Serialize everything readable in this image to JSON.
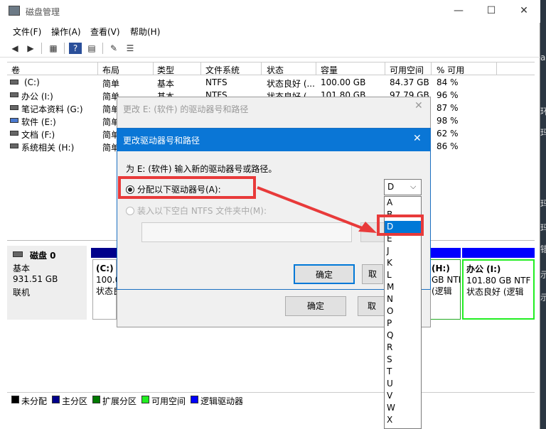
{
  "window": {
    "title": "磁盘管理",
    "minimize": "—",
    "maximize": "☐",
    "close": "✕"
  },
  "menu": [
    "文件(F)",
    "操作(A)",
    "查看(V)",
    "帮助(H)"
  ],
  "toolbar": [
    "◀",
    "▶",
    "▦",
    "?",
    "▤",
    "✎",
    "☰"
  ],
  "volume_table": {
    "columns": [
      "卷",
      "布局",
      "类型",
      "文件系统",
      "状态",
      "容量",
      "可用空间",
      "% 可用"
    ],
    "rows": [
      [
        "(C:)",
        "简单",
        "基本",
        "NTFS",
        "状态良好 (...",
        "100.00 GB",
        "84.37 GB",
        "84 %"
      ],
      [
        "办公 (I:)",
        "简单",
        "基本",
        "NTFS",
        "状态良好 (...",
        "101.80 GB",
        "97.79 GB",
        "96 %"
      ],
      [
        "笔记本资料 (G:)",
        "简单",
        "",
        "",
        "",
        "",
        "",
        "87 %"
      ],
      [
        "软件 (E:)",
        "简单",
        "",
        "",
        "",
        "",
        "",
        "98 %"
      ],
      [
        "文档 (F:)",
        "简单",
        "",
        "",
        "",
        "",
        "",
        "62 %"
      ],
      [
        "系统相关 (H:)",
        "简单",
        "",
        "",
        "",
        "",
        "",
        "86 %"
      ]
    ]
  },
  "disk": {
    "name": "磁盘 0",
    "type": "基本",
    "size": "931.51 GB",
    "status": "联机"
  },
  "segments": [
    {
      "line1": "(C:)",
      "line2": "100.0",
      "line3": "状态良"
    },
    {
      "line1": "(H:)",
      "line2": "GB NTF",
      "line3": "(逻辑"
    },
    {
      "line1": "办公 (I:)",
      "line2": "101.80 GB NTF",
      "line3": "状态良好 (逻辑"
    }
  ],
  "legend": [
    "未分配",
    "主分区",
    "扩展分区",
    "可用空间",
    "逻辑驱动器"
  ],
  "colors": {
    "unalloc": "#000000",
    "primary": "#00008b",
    "extended": "#007a00",
    "free": "#22ee22",
    "logical": "#0000ff",
    "accent": "#0a76d6",
    "annotation": "#e83a3a"
  },
  "dialog1": {
    "title": "更改 E: (软件) 的驱动器号和路径",
    "ok": "确定",
    "cancel": "取",
    "close": "✕"
  },
  "dialog2": {
    "title": "更改驱动器号和路径",
    "prompt": "为 E: (软件) 输入新的驱动器号或路径。",
    "radio_assign": "分配以下驱动器号(A):",
    "radio_mount": "装入以下空白 NTFS 文件夹中(M):",
    "ok": "确定",
    "cancel": "取",
    "close": "✕"
  },
  "dropdown": {
    "selected": "D",
    "arrow": "⌵",
    "options": [
      "A",
      "B",
      "D",
      "E",
      "J",
      "K",
      "L",
      "M",
      "N",
      "O",
      "P",
      "Q",
      "R",
      "S",
      "T",
      "U",
      "V",
      "W",
      "X"
    ]
  },
  "right_strip": [
    "a",
    "环",
    "玛",
    "玛",
    "玛",
    "玛",
    "错",
    "示",
    "示"
  ]
}
